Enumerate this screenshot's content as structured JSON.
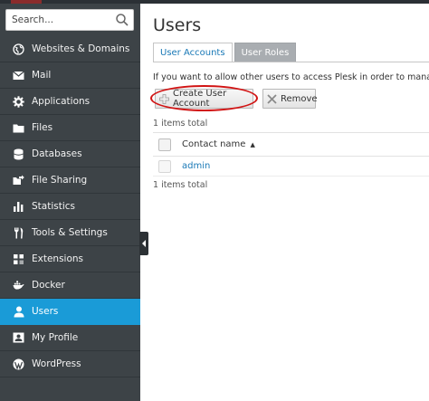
{
  "search": {
    "placeholder": "Search..."
  },
  "sidebar": {
    "items": [
      {
        "label": "Websites & Domains",
        "icon": "globe-icon"
      },
      {
        "label": "Mail",
        "icon": "envelope-icon"
      },
      {
        "label": "Applications",
        "icon": "gear-icon"
      },
      {
        "label": "Files",
        "icon": "folder-icon"
      },
      {
        "label": "Databases",
        "icon": "database-icon"
      },
      {
        "label": "File Sharing",
        "icon": "file-sharing-icon"
      },
      {
        "label": "Statistics",
        "icon": "bar-chart-icon"
      },
      {
        "label": "Tools & Settings",
        "icon": "tools-icon"
      },
      {
        "label": "Extensions",
        "icon": "puzzle-icon"
      },
      {
        "label": "Docker",
        "icon": "docker-icon"
      },
      {
        "label": "Users",
        "icon": "user-icon",
        "active": true
      },
      {
        "label": "My Profile",
        "icon": "profile-card-icon"
      },
      {
        "label": "WordPress",
        "icon": "wordpress-icon"
      }
    ]
  },
  "page": {
    "title": "Users",
    "tabs": [
      {
        "label": "User Accounts",
        "active": true
      },
      {
        "label": "User Roles",
        "active": false
      }
    ],
    "hint": "If you want to allow other users to access Plesk in order to manage web",
    "toolbar": {
      "create_label": "Create User Account",
      "remove_label": "Remove"
    },
    "count_top": "1 items total",
    "count_bottom": "1 items total",
    "table": {
      "column": "Contact name",
      "sort": "ascending",
      "rows": [
        {
          "contact_name": "admin"
        }
      ]
    }
  },
  "colors": {
    "sidebar_bg": "#3d4347",
    "active_bg": "#1a9bd7",
    "link": "#1a79b7",
    "highlight_ring": "#d11414"
  }
}
